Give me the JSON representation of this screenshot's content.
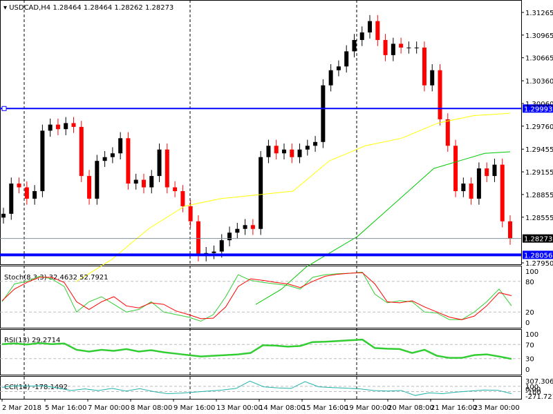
{
  "header": {
    "symbol": "USDCAD,H4",
    "ohlc": "1.28464 1.28464 1.28262 1.28273"
  },
  "colors": {
    "bull": "#000000",
    "bear": "#ff0000",
    "hline": "#0000ff",
    "ma_fast": "#ffff00",
    "ma_slow": "#00c800",
    "stoch_main": "#32cd32",
    "stoch_signal": "#ff0000",
    "rsi": "#32cd32",
    "cci": "#20b2aa"
  },
  "chart_data": [
    {
      "type": "candlestick",
      "title": "USDCAD,H4",
      "ylim": [
        1.2795,
        1.3127
      ],
      "price_ticks": [
        "1.31265",
        "1.30965",
        "1.30665",
        "1.30360",
        "1.30060",
        "1.29760",
        "1.29455",
        "1.29155",
        "1.28855",
        "1.28555",
        "1.27950"
      ],
      "closes": [
        1.286,
        1.29,
        1.2895,
        1.288,
        1.289,
        1.297,
        1.2978,
        1.2972,
        1.298,
        1.2975,
        1.291,
        1.288,
        1.293,
        1.2935,
        1.294,
        1.296,
        1.29,
        1.2905,
        1.2895,
        1.291,
        1.2945,
        1.2895,
        1.289,
        1.287,
        1.285,
        1.2805,
        1.2808,
        1.281,
        1.2825,
        1.2835,
        1.284,
        1.2845,
        1.284,
        1.2935,
        1.295,
        1.294,
        1.2945,
        1.2935,
        1.2945,
        1.295,
        1.2955,
        1.303,
        1.305,
        1.3055,
        1.3075,
        1.309,
        1.31,
        1.3115,
        1.309,
        1.307,
        1.3085,
        1.308,
        1.308,
        1.308,
        1.303,
        1.305,
        1.2985,
        1.295,
        1.289,
        1.29,
        1.288,
        1.292,
        1.291,
        1.2925,
        1.285,
        1.2827
      ],
      "ma_fast": [
        1.277,
        1.28,
        1.284,
        1.287,
        1.288,
        1.2885,
        1.289,
        1.293,
        1.295,
        1.296,
        1.298,
        1.299,
        1.2993
      ],
      "ma_slow": [
        1.274,
        1.276,
        1.279,
        1.281,
        1.283,
        1.286,
        1.289,
        1.292,
        1.293,
        1.294,
        1.2942
      ],
      "hlines": [
        {
          "label": "1.29993",
          "value": 1.29993
        },
        {
          "label": "1.28056",
          "value": 1.28056
        }
      ],
      "current": {
        "label": "1.28273",
        "value": 1.28273
      }
    },
    {
      "type": "line",
      "title": "Stoch(8,3,3) 32.4632 52.7921",
      "ticks": [
        "100",
        "80",
        "20",
        "0"
      ],
      "main": [
        40,
        75,
        80,
        90,
        85,
        70,
        20,
        40,
        50,
        35,
        20,
        25,
        40,
        20,
        15,
        10,
        2,
        15,
        50,
        93,
        82,
        78,
        75,
        72,
        65,
        88,
        93,
        95,
        96,
        98,
        55,
        38,
        42,
        40,
        20,
        18,
        5,
        5,
        20,
        40,
        65,
        32
      ],
      "signal": [
        42,
        65,
        78,
        88,
        88,
        78,
        40,
        25,
        40,
        50,
        32,
        28,
        38,
        35,
        22,
        15,
        7,
        8,
        30,
        70,
        85,
        82,
        78,
        75,
        68,
        80,
        90,
        94,
        96,
        97,
        75,
        40,
        38,
        42,
        30,
        20,
        10,
        5,
        12,
        32,
        58,
        52
      ]
    },
    {
      "type": "line",
      "title": "RSI(13) 29.2714",
      "ticks": [
        "100",
        "70",
        "30",
        "0"
      ],
      "values": [
        71,
        73,
        70,
        74,
        71,
        73,
        55,
        50,
        55,
        52,
        57,
        50,
        54,
        48,
        44,
        40,
        36,
        38,
        40,
        42,
        46,
        68,
        67,
        64,
        66,
        77,
        78,
        80,
        82,
        84,
        60,
        58,
        57,
        46,
        55,
        38,
        32,
        32,
        40,
        42,
        36,
        29
      ]
    },
    {
      "type": "line",
      "title": "CCI(14) -178.1492",
      "ticks": [
        "307.3062",
        "100",
        "0.00",
        "-100",
        "-271.7215"
      ],
      "values": [
        60,
        120,
        110,
        120,
        40,
        -60,
        0,
        -60,
        20,
        -80,
        10,
        -100,
        -180,
        -160,
        -120,
        -80,
        -40,
        20,
        300,
        80,
        40,
        20,
        280,
        80,
        50,
        30,
        0,
        -60,
        -80,
        -60,
        -250,
        -150,
        -180,
        -120,
        -80,
        -40,
        -50,
        -180
      ]
    }
  ],
  "time_labels": [
    "2 Mar 2018",
    "5 Mar 16:00",
    "7 Mar 00:00",
    "8 Mar 08:00",
    "9 Mar 16:00",
    "13 Mar 00:00",
    "14 Mar 08:00",
    "15 Mar 16:00",
    "19 Mar 00:00",
    "20 Mar 08:00",
    "21 Mar 16:00",
    "23 Mar 00:00"
  ]
}
